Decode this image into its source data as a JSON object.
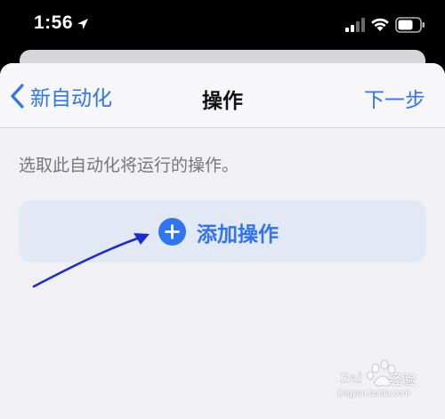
{
  "status_bar": {
    "time": "1:56",
    "icons": [
      "location-icon",
      "signal-icon",
      "wifi-icon",
      "battery-icon"
    ]
  },
  "nav": {
    "back_label": "新自动化",
    "title": "操作",
    "next_label": "下一步"
  },
  "content": {
    "description": "选取此自动化将运行的操作。",
    "add_action_label": "添加操作"
  },
  "watermark": {
    "brand": "经验",
    "url": "jingyan.baidu.com"
  },
  "colors": {
    "accent": "#2f74f0",
    "sheet_bg": "#f0f0f5",
    "button_bg": "#e3e8f5",
    "annotation_arrow": "#1a2bd6"
  }
}
